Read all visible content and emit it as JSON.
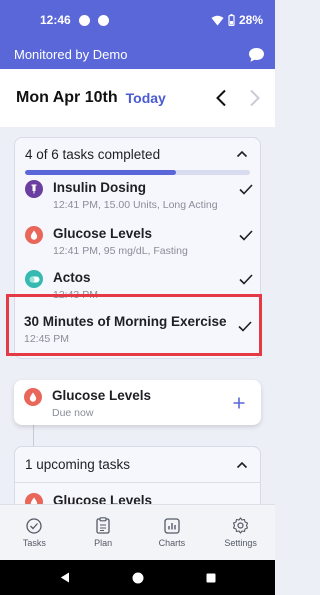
{
  "status_bar": {
    "time": "12:46",
    "battery": "28%"
  },
  "app_bar": {
    "title": "Monitored by Demo",
    "chat_icon": "chat-bubble-icon"
  },
  "date_nav": {
    "date": "Mon Apr 10th",
    "today_label": "Today"
  },
  "completed_section": {
    "header": "4 of 6 tasks completed",
    "progress": 0.67,
    "tasks": [
      {
        "title": "Insulin Dosing",
        "subtitle": "12:41 PM, 15.00 Units, Long Acting",
        "icon": "syringe-icon",
        "icon_color": "#6a3fa0"
      },
      {
        "title": "Glucose Levels",
        "subtitle": "12:41 PM, 95 mg/dL, Fasting",
        "icon": "blood-drop-icon",
        "icon_color": "#e8665a"
      },
      {
        "title": "Actos",
        "subtitle": "12:43 PM",
        "icon": "pill-icon",
        "icon_color": "#35b9b0"
      },
      {
        "title": "30 Minutes of Morning Exercise",
        "subtitle": "12:45 PM"
      }
    ]
  },
  "due_task": {
    "title": "Glucose Levels",
    "subtitle": "Due now",
    "icon": "blood-drop-icon",
    "icon_color": "#e8665a"
  },
  "upcoming_section": {
    "header": "1 upcoming tasks",
    "tasks": [
      {
        "title": "Glucose Levels",
        "icon": "blood-drop-icon",
        "icon_color": "#e8665a"
      }
    ]
  },
  "tabbar": {
    "tabs": [
      {
        "label": "Tasks",
        "icon": "check-circle-icon"
      },
      {
        "label": "Plan",
        "icon": "clipboard-icon"
      },
      {
        "label": "Charts",
        "icon": "bar-chart-icon"
      },
      {
        "label": "Settings",
        "icon": "gear-icon"
      }
    ]
  },
  "colors": {
    "brand": "#5a67d8",
    "highlight": "#e53945"
  }
}
